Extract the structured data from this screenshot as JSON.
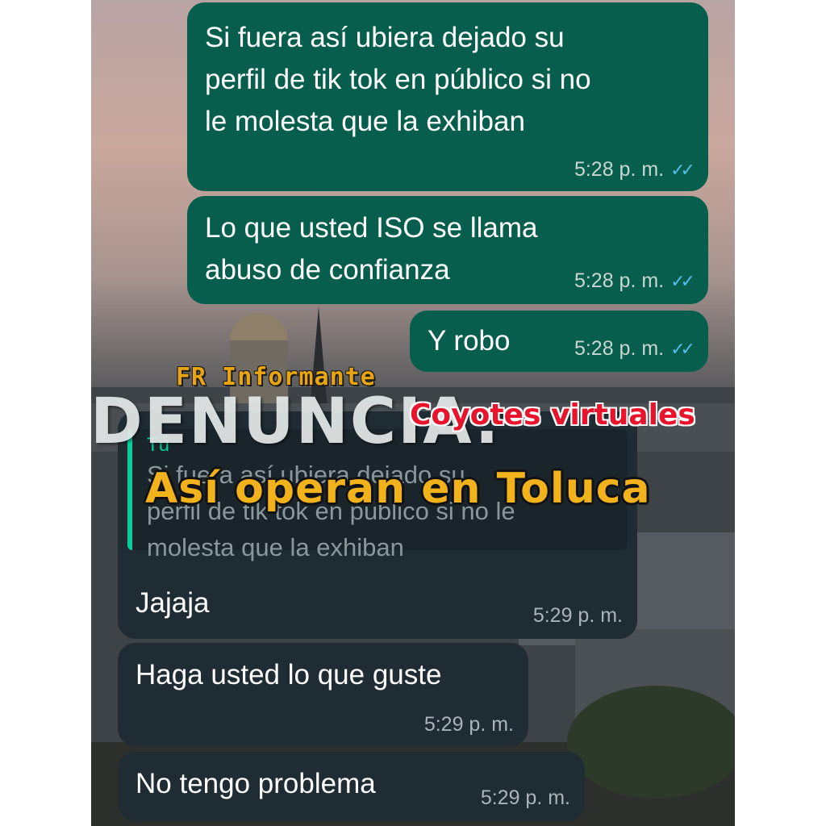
{
  "messages": [
    {
      "text": "Si fuera así ubiera dejado su\nperfil de tik tok en público si no\nle molesta que la exhiban",
      "time": "5:28 p. m."
    },
    {
      "text": "Lo que usted ISO se llama\nabuso de confianza",
      "time": "5:28 p. m."
    },
    {
      "text": "Y robo",
      "time": "5:28 p. m."
    },
    {
      "text": "Jajaja",
      "time": "5:29 p. m.",
      "quote_author": "Tú",
      "quote_text": "Si fuera así ubiera dejado su\nperfil de tik tok en público si no le\nmolesta que la exhiban"
    },
    {
      "text": "Haga usted lo que guste",
      "time": "5:29 p. m."
    },
    {
      "text": "No tengo problema",
      "time": "5:29 p. m."
    }
  ],
  "read_receipt_icon": "double-check-icon",
  "read_receipt_glyph": "✓✓",
  "overlay": {
    "source": "FR Informante",
    "headline": "DENUNCIA:",
    "subheadline": "Coyotes virtuales",
    "caption": "Así operan en Toluca"
  },
  "colors": {
    "outgoing_bubble": "#075e4d",
    "incoming_bubble": "#1f2c33",
    "read_ticks": "#53bdeb",
    "caption": "#f2b21c",
    "subheadline": "#e8142b"
  }
}
